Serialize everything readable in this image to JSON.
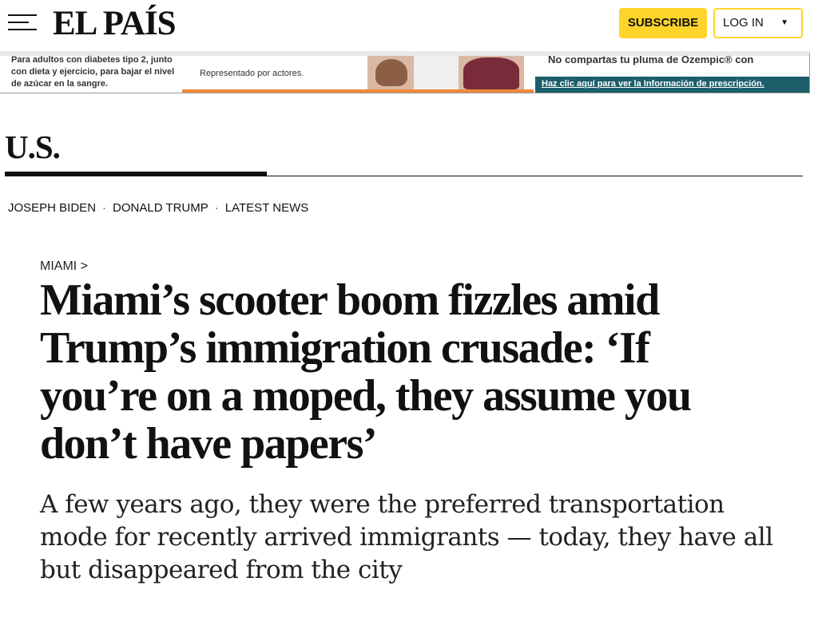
{
  "header": {
    "logo": "EL PAÍS",
    "subscribe_label": "SUBSCRIBE",
    "login_label": "LOG IN",
    "login_caret": "▼"
  },
  "ad": {
    "left_text": "Para adultos con diabetes tipo 2, junto con dieta y ejercicio, para bajar el nivel de azúcar en la sangre.",
    "mid_text": "Representado por actores.",
    "right_warning": "No compartas tu pluma de Ozempic® con",
    "right_link": "Haz clic aquí para ver la Información de prescripción.",
    "accent_orange": "#f08a3c",
    "accent_teal": "#1c5f6b"
  },
  "section": {
    "title": "U.S."
  },
  "subnav": {
    "items": [
      "JOSEPH BIDEN",
      "DONALD TRUMP",
      "LATEST NEWS"
    ],
    "separator": "·"
  },
  "article": {
    "kicker": "MIAMI >",
    "headline": "Miami’s scooter boom fizzles amid Trump’s immigration crusade: ‘If you’re on a moped, they assume you don’t have papers’",
    "deck": "A few years ago, they were the preferred transportation mode for recently arrived immigrants — today, they have all but disappeared from the city"
  },
  "colors": {
    "subscribe_yellow": "#ffd42a",
    "text": "#111111"
  }
}
